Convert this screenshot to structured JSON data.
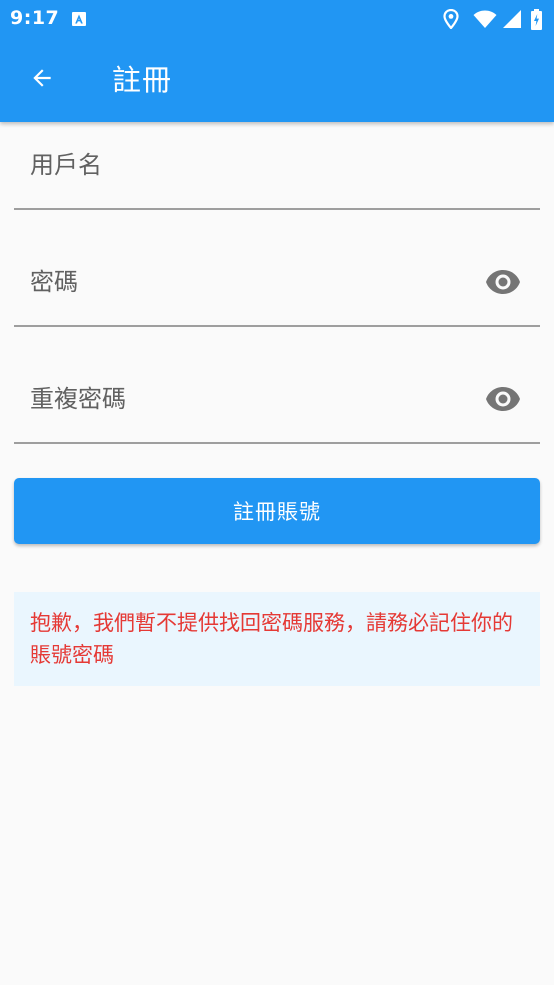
{
  "status_bar": {
    "time": "9:17"
  },
  "toolbar": {
    "title": "註冊"
  },
  "form": {
    "username": {
      "placeholder": "用戶名",
      "value": ""
    },
    "password": {
      "placeholder": "密碼",
      "value": ""
    },
    "confirm_password": {
      "placeholder": "重複密碼",
      "value": ""
    },
    "submit_label": "註冊賬號"
  },
  "notice": {
    "text": "抱歉，我們暫不提供找回密碼服務，請務必記住你的賬號密碼"
  },
  "icons": {
    "back": "arrow-back-icon",
    "visibility": "eye-icon",
    "status": [
      "a-notification-icon",
      "location-icon",
      "wifi-icon",
      "signal-icon",
      "battery-icon"
    ]
  },
  "colors": {
    "primary": "#2196f3",
    "background": "#fafafa",
    "notice_background": "#eaf6fe",
    "notice_text": "#e53935",
    "divider": "#9e9e9e",
    "icon_gray": "#757575"
  }
}
